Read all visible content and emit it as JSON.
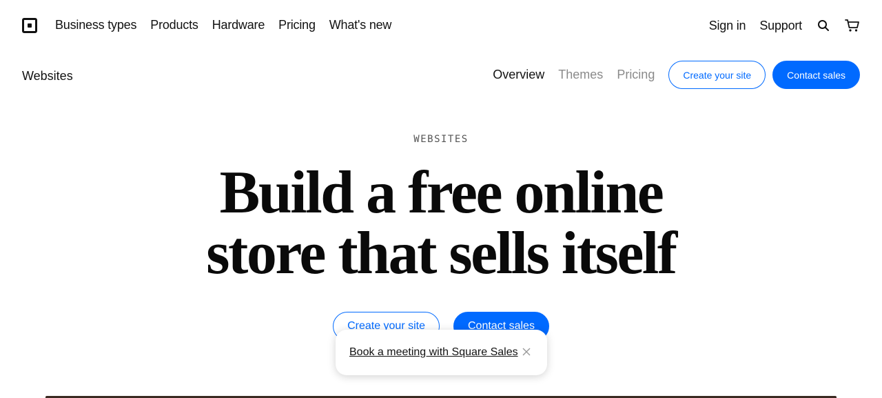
{
  "topnav": {
    "logo": "square-logo",
    "left_links": [
      "Business types",
      "Products",
      "Hardware",
      "Pricing",
      "What's new"
    ],
    "sign_in": "Sign in",
    "support": "Support",
    "search_icon": "search-icon",
    "cart_icon": "cart-icon"
  },
  "subnav": {
    "title": "Websites",
    "tabs": [
      {
        "label": "Overview",
        "active": true
      },
      {
        "label": "Themes",
        "active": false
      },
      {
        "label": "Pricing",
        "active": false
      }
    ],
    "create_label": "Create your site",
    "contact_label": "Contact sales"
  },
  "hero": {
    "eyebrow": "WEBSITES",
    "headline_line1": "Build a free online",
    "headline_line2": "store that sells itself",
    "create_label": "Create your site",
    "contact_label": "Contact sales"
  },
  "popup": {
    "link_text": "Book a meeting with Square Sales",
    "close_icon": "close-icon"
  },
  "colors": {
    "accent": "#006aff",
    "text": "#111111",
    "muted": "#8a8a8a"
  }
}
